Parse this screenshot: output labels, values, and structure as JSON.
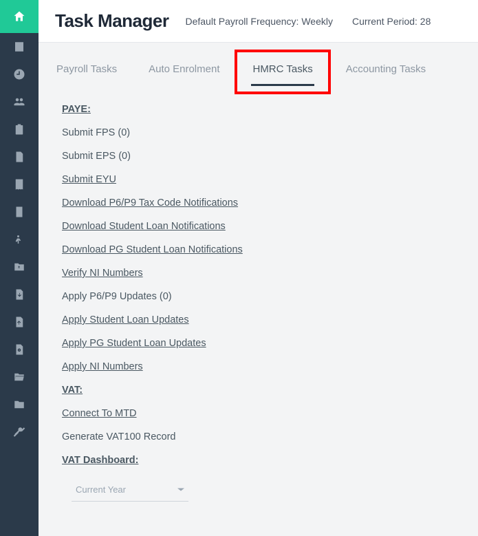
{
  "sidebar": {
    "items": [
      {
        "name": "home-icon"
      },
      {
        "name": "building-icon"
      },
      {
        "name": "clock-icon"
      },
      {
        "name": "users-icon"
      },
      {
        "name": "clipboard-icon"
      },
      {
        "name": "document-icon"
      },
      {
        "name": "receipt-icon"
      },
      {
        "name": "page-icon"
      },
      {
        "name": "person-leave-icon"
      },
      {
        "name": "folder-money-icon"
      },
      {
        "name": "file-download-icon"
      },
      {
        "name": "file-upload-icon"
      },
      {
        "name": "file-settings-icon"
      },
      {
        "name": "folder-open-icon"
      },
      {
        "name": "folder-icon"
      },
      {
        "name": "tools-icon"
      }
    ]
  },
  "header": {
    "title": "Task Manager",
    "frequency_label": "Default Payroll Frequency: Weekly",
    "period_label": "Current Period: 28"
  },
  "tabs": [
    {
      "label": "Payroll Tasks",
      "active": false
    },
    {
      "label": "Auto Enrolment",
      "active": false
    },
    {
      "label": "HMRC Tasks",
      "active": true,
      "highlighted": true
    },
    {
      "label": "Accounting Tasks",
      "active": false
    }
  ],
  "tasks": [
    {
      "label": "PAYE:",
      "type": "heading"
    },
    {
      "label": "Submit FPS (0)",
      "type": "plain"
    },
    {
      "label": "Submit EPS (0)",
      "type": "plain"
    },
    {
      "label": "Submit EYU",
      "type": "link"
    },
    {
      "label": "Download P6/P9 Tax Code Notifications",
      "type": "link"
    },
    {
      "label": "Download Student Loan Notifications",
      "type": "link"
    },
    {
      "label": "Download PG Student Loan Notifications",
      "type": "link"
    },
    {
      "label": "Verify NI Numbers",
      "type": "link"
    },
    {
      "label": "Apply P6/P9 Updates (0)",
      "type": "plain"
    },
    {
      "label": "Apply Student Loan Updates",
      "type": "link"
    },
    {
      "label": "Apply PG Student Loan Updates",
      "type": "link"
    },
    {
      "label": "Apply NI Numbers",
      "type": "link"
    },
    {
      "label": "VAT:",
      "type": "heading"
    },
    {
      "label": "Connect To MTD",
      "type": "link"
    },
    {
      "label": "Generate VAT100 Record",
      "type": "plain"
    },
    {
      "label": "VAT Dashboard:",
      "type": "heading"
    }
  ],
  "year_select": {
    "value": "Current Year"
  }
}
